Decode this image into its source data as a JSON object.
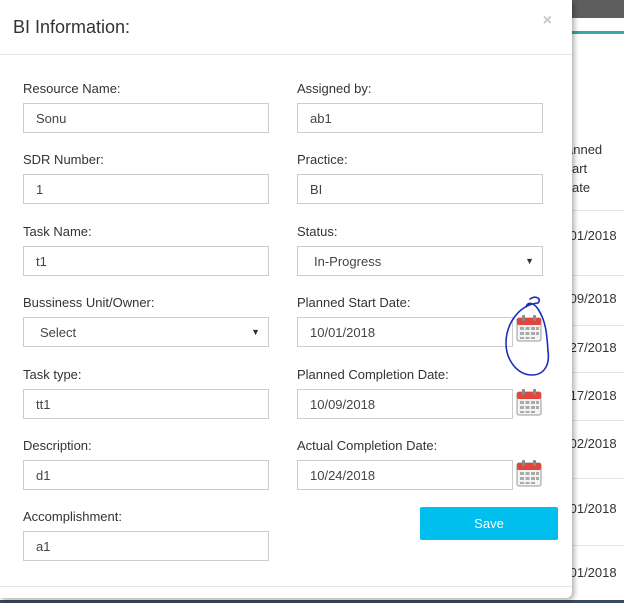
{
  "background": {
    "header_cell": [
      "anned",
      "art",
      "ate"
    ],
    "cells": [
      "/01/2018",
      "/09/2018",
      "/27/2018",
      "/17/2018",
      "/02/2018",
      "/01/2018",
      "/01/2018"
    ]
  },
  "modal": {
    "title": "BI Information:",
    "close_glyph": "×",
    "save_label": "Save"
  },
  "fields": {
    "resource_name": {
      "label": "Resource Name:",
      "value": "Sonu"
    },
    "assigned_by": {
      "label": "Assigned by:",
      "value": "ab1"
    },
    "sdr_number": {
      "label": "SDR Number:",
      "value": "1"
    },
    "practice": {
      "label": "Practice:",
      "value": "BI"
    },
    "task_name": {
      "label": "Task Name:",
      "value": "t1"
    },
    "status": {
      "label": "Status:",
      "value": "In-Progress"
    },
    "business_unit": {
      "label": "Bussiness Unit/Owner:",
      "value": "Select"
    },
    "planned_start": {
      "label": "Planned Start Date:",
      "value": "10/01/2018"
    },
    "task_type": {
      "label": "Task type:",
      "value": "tt1"
    },
    "planned_completion": {
      "label": "Planned Completion Date:",
      "value": "10/09/2018"
    },
    "description": {
      "label": "Description:",
      "value": "d1"
    },
    "actual_completion": {
      "label": "Actual Completion Date:",
      "value": "10/24/2018"
    },
    "accomplishment": {
      "label": "Accomplishment:",
      "value": "a1"
    }
  },
  "icons": {
    "dropdown": "chevron-down-icon",
    "calendar": "calendar-icon",
    "close": "close-icon"
  },
  "colors": {
    "save_button": "#00bfef",
    "calendar_red": "#e2453c",
    "annotation": "#1a2fb8"
  }
}
